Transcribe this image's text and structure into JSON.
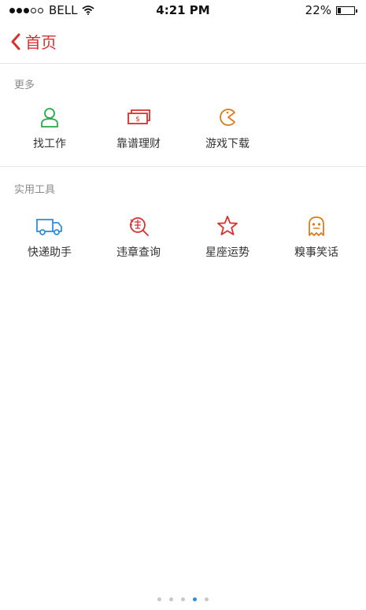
{
  "status_bar": {
    "carrier": "BELL",
    "time": "4:21 PM",
    "battery": "22%",
    "battery_level": 0.22,
    "signal_bars_filled": 3
  },
  "nav": {
    "back_label": "首页"
  },
  "sections": [
    {
      "title": "更多",
      "items": [
        {
          "label": "找工作",
          "icon": "person-icon",
          "color": "#2aa84a"
        },
        {
          "label": "靠谱理财",
          "icon": "money-icon",
          "color": "#d9302f"
        },
        {
          "label": "游戏下载",
          "icon": "pacman-icon",
          "color": "#e07a18"
        }
      ]
    },
    {
      "title": "实用工具",
      "items": [
        {
          "label": "快递助手",
          "icon": "truck-icon",
          "color": "#2f8fdd"
        },
        {
          "label": "违章查询",
          "icon": "violation-search-icon",
          "color": "#d9302f"
        },
        {
          "label": "星座运势",
          "icon": "star-icon",
          "color": "#d9302f"
        },
        {
          "label": "糗事笑话",
          "icon": "ghost-icon",
          "color": "#e07a18"
        }
      ]
    }
  ],
  "pager": {
    "count": 5,
    "active": 4
  }
}
